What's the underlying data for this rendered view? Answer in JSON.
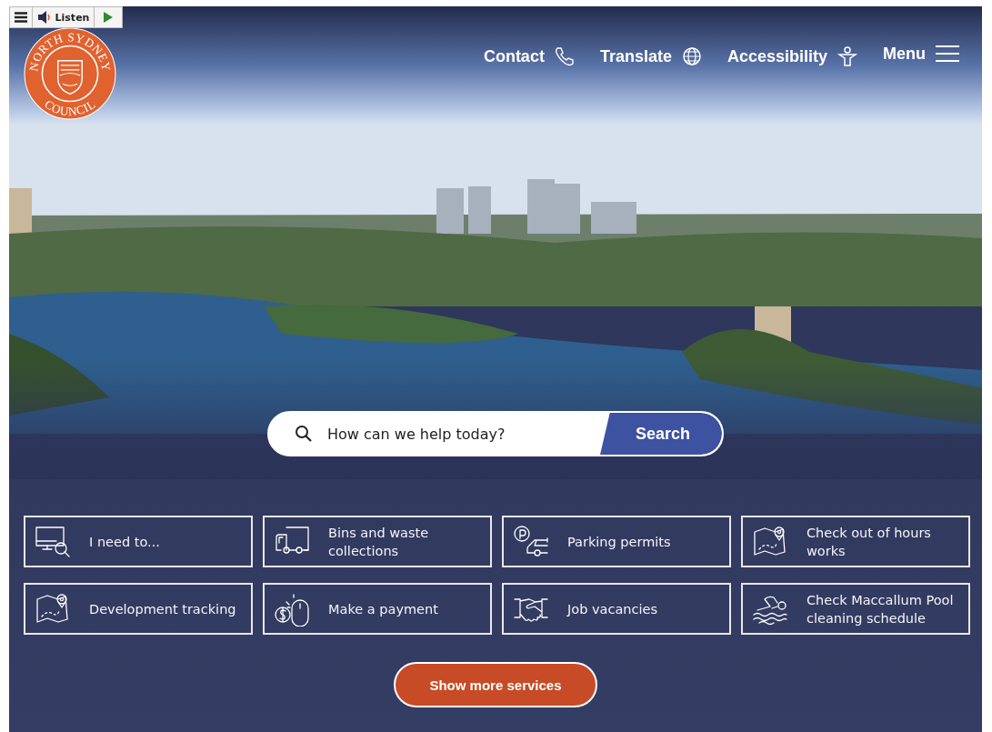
{
  "listen_bar": {
    "label": "Listen"
  },
  "logo": {
    "top_text": "NORTH SYDNEY",
    "bottom_text": "COUNCIL"
  },
  "nav": [
    {
      "label": "Contact"
    },
    {
      "label": "Translate"
    },
    {
      "label": "Accessibility"
    },
    {
      "label": "Menu"
    }
  ],
  "search": {
    "placeholder": "How can we help today?",
    "button": "Search"
  },
  "services": [
    {
      "label": "I need to..."
    },
    {
      "label": "Bins and waste collections"
    },
    {
      "label": "Parking permits"
    },
    {
      "label": "Check out of hours works"
    },
    {
      "label": "Development tracking"
    },
    {
      "label": "Make a payment"
    },
    {
      "label": "Job vacancies"
    },
    {
      "label": "Check Maccallum Pool cleaning schedule"
    }
  ],
  "more_button": "Show more services"
}
